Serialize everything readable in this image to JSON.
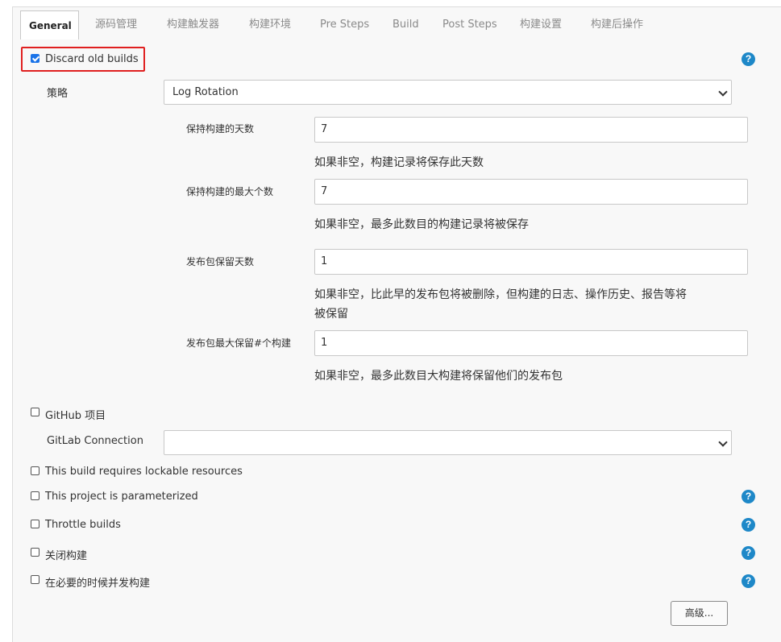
{
  "tabs": [
    "General",
    "源码管理",
    "构建触发器",
    "构建环境",
    "Pre Steps",
    "Build",
    "Post Steps",
    "构建设置",
    "构建后操作"
  ],
  "discard": {
    "label": "Discard old builds",
    "checked": true,
    "strategy_label": "策略",
    "strategy_value": "Log Rotation",
    "fields": [
      {
        "label": "保持构建的天数",
        "value": "7",
        "help": "如果非空，构建记录将保存此天数"
      },
      {
        "label": "保持构建的最大个数",
        "value": "7",
        "help": "如果非空，最多此数目的构建记录将被保存"
      },
      {
        "label": "发布包保留天数",
        "value": "1",
        "help_line1": "如果非空，比此早的发布包将被删除，但构建的日志、操作历史、报告等将",
        "help_line2": "被保留"
      },
      {
        "label": "发布包最大保留#个构建",
        "value": "1",
        "help": "如果非空，最多此数目大构建将保留他们的发布包"
      }
    ]
  },
  "options": {
    "github": "GitHub 项目",
    "gitlab_label": "GitLab Connection",
    "gitlab_value": "",
    "lockable": "This build requires lockable resources",
    "parameterized": "This project is parameterized",
    "throttle": "Throttle builds",
    "disable": "关闭构建",
    "concurrent": "在必要的时候并发构建"
  },
  "help_glyph": "?",
  "advanced_button": "高级...",
  "colors": {
    "accent": "#1e88c8",
    "highlight": "#e02020",
    "checkbox": "#1a73e8"
  }
}
